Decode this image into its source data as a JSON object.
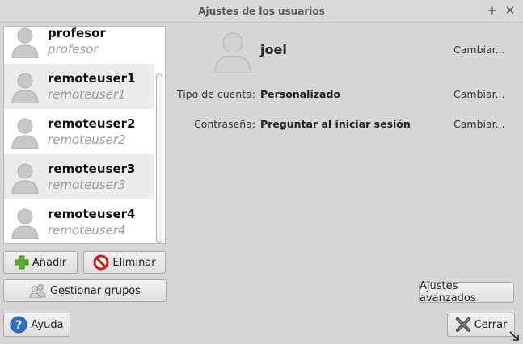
{
  "window": {
    "title": "Ajustes de los usuarios",
    "maximize_glyph": "+",
    "close_glyph": "✕"
  },
  "user_list": [
    {
      "name": "profesor",
      "login": "profesor"
    },
    {
      "name": "remoteuser1",
      "login": "remoteuser1"
    },
    {
      "name": "remoteuser2",
      "login": "remoteuser2"
    },
    {
      "name": "remoteuser3",
      "login": "remoteuser3"
    },
    {
      "name": "remoteuser4",
      "login": "remoteuser4"
    }
  ],
  "buttons": {
    "add": "Añadir",
    "remove": "Eliminar",
    "manage_groups": "Gestionar grupos",
    "help": "Ayuda",
    "advanced": "Ajustes avanzados",
    "close": "Cerrar"
  },
  "details": {
    "display_name": "joel",
    "change_name": "Cambiar...",
    "account_type_label": "Tipo de cuenta:",
    "account_type_value": "Personalizado",
    "change_account_type": "Cambiar...",
    "password_label": "Contraseña:",
    "password_value": "Preguntar al iniciar sesión",
    "change_password": "Cambiar..."
  },
  "icons": {
    "avatar": "user-avatar-icon",
    "add": "green-plus-icon",
    "remove": "red-no-entry-icon",
    "groups": "users-group-icon",
    "help": "blue-question-icon",
    "close": "x-icon"
  },
  "colors": {
    "background": "#d6d6d6",
    "list_bg": "#ffffff",
    "list_alt_row": "#ececec",
    "add_green": "#58b02c",
    "remove_red": "#cc1a1a",
    "help_blue": "#2f6fcc"
  }
}
